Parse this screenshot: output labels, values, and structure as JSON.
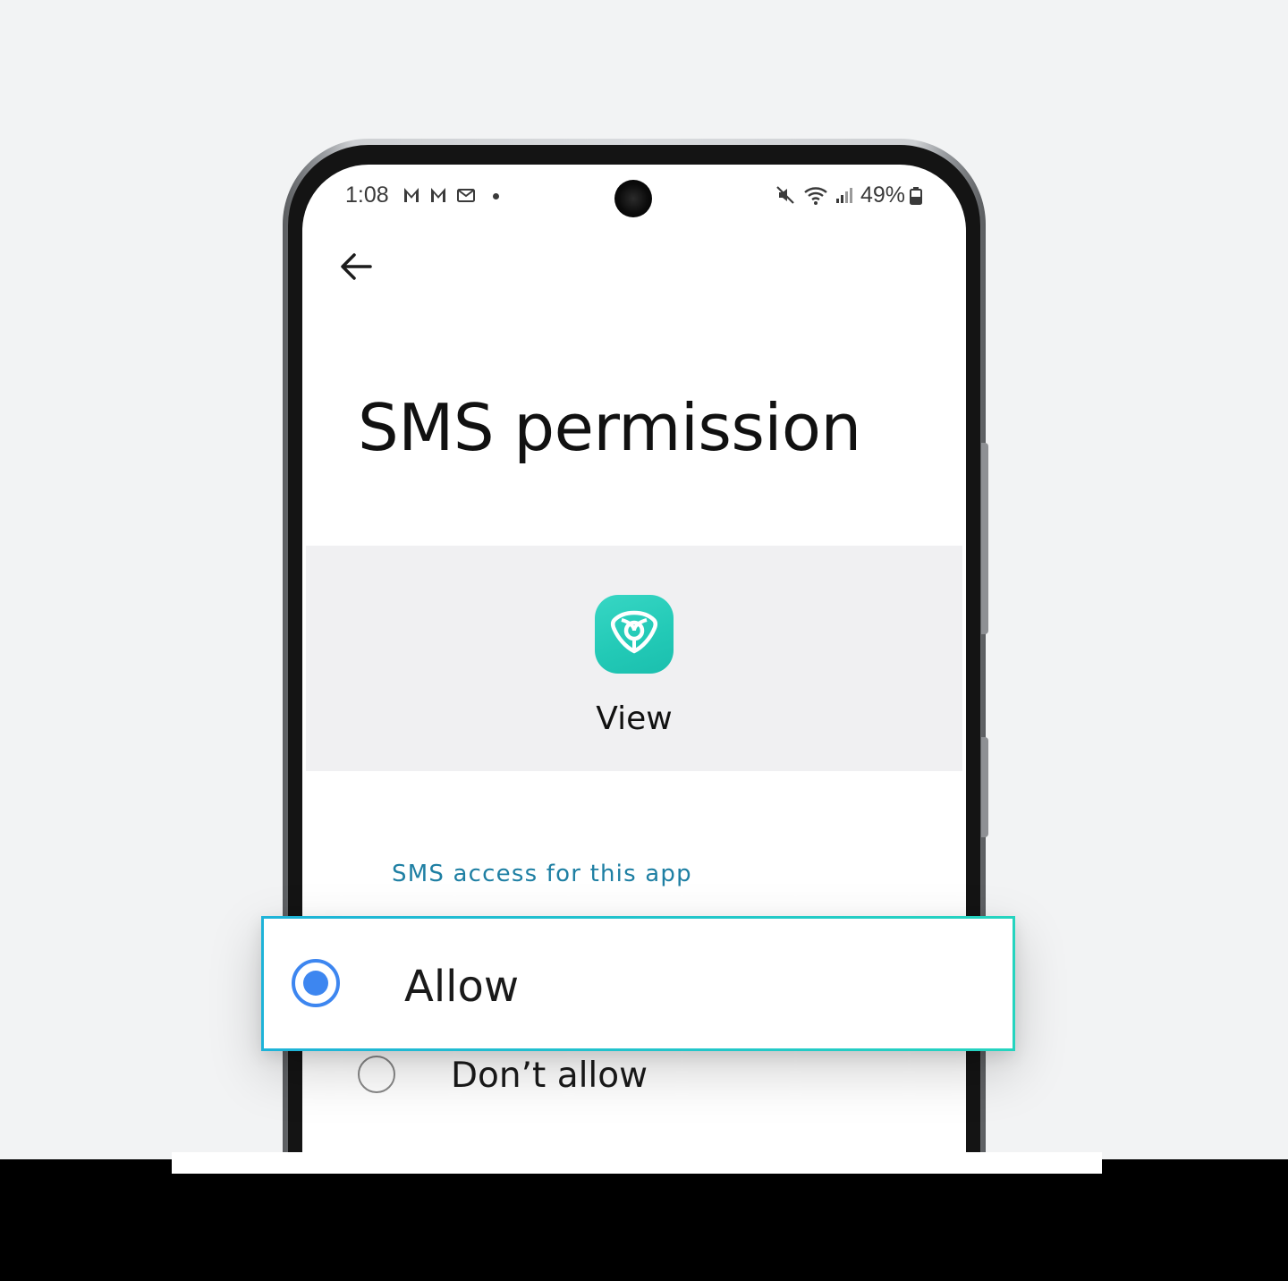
{
  "status_bar": {
    "time": "1:08",
    "battery": "49%",
    "left_icons": [
      "notification-m-icon",
      "notification-m-icon",
      "mail-icon",
      "dot-icon"
    ],
    "right_icons": [
      "mute-icon",
      "wifi-icon",
      "signal-icon",
      "battery-icon"
    ]
  },
  "header": {
    "back_icon": "arrow-left-icon",
    "title": "SMS permission"
  },
  "app": {
    "name": "View",
    "icon": "view-app-icon",
    "icon_color": "#2ccbb8"
  },
  "section": {
    "label": "SMS access for this app"
  },
  "options": [
    {
      "label": "Allow",
      "selected": true
    },
    {
      "label": "Don’t allow",
      "selected": false
    }
  ],
  "colors": {
    "accent_radio": "#3d86f0",
    "section_label": "#1e7fa3",
    "highlight_border": "#22c7c0"
  }
}
